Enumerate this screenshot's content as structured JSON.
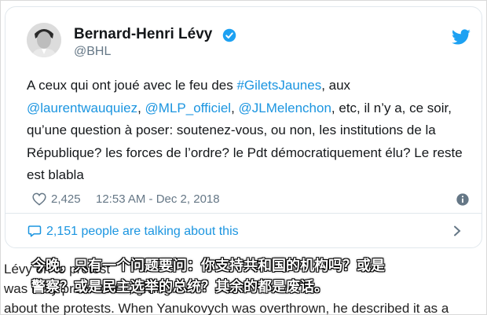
{
  "tweet": {
    "author_name": "Bernard-Henri Lévy",
    "handle": "@BHL",
    "body_segments": [
      {
        "text": "A ceux qui ont joué avec le feu des ",
        "link": false
      },
      {
        "text": "#GiletsJaunes",
        "link": true
      },
      {
        "text": ", aux ",
        "link": false
      },
      {
        "text": "@laurentwauquiez",
        "link": true
      },
      {
        "text": ", ",
        "link": false
      },
      {
        "text": "@MLP_officiel",
        "link": true
      },
      {
        "text": ", ",
        "link": false
      },
      {
        "text": "@JLMelenchon",
        "link": true
      },
      {
        "text": ", etc, il n’y a, ce soir, qu’une question à poser: soutenez-vous, ou non, les institutions de la République? les forces de l’ordre? le Pdt démocratiquement élu? Le reste est blabla",
        "link": false
      }
    ],
    "likes": "2,425",
    "timestamp": "12:53 AM - Dec 2, 2018",
    "talking": "2,151 people are talking about this"
  },
  "article_lines": [
    "Lévy                                                                                       on to protest",
    "was                                                                                   ively promoted it, giving",
    "about the protests. When Yanukovych was overthrown, he described it as a"
  ],
  "subtitle": {
    "line1": "今晚，只有一个问题要问：你支持共和国的机构吗？或是",
    "line2": "警察？或是民主选举的总统？其余的都是废话。"
  },
  "colors": {
    "link": "#1b95e0",
    "muted": "#657786",
    "text": "#14171a"
  },
  "icons": [
    "avatar",
    "verified-badge-icon",
    "twitter-bird-icon",
    "heart-icon",
    "info-icon",
    "speech-bubble-icon",
    "chevron-right-icon"
  ]
}
